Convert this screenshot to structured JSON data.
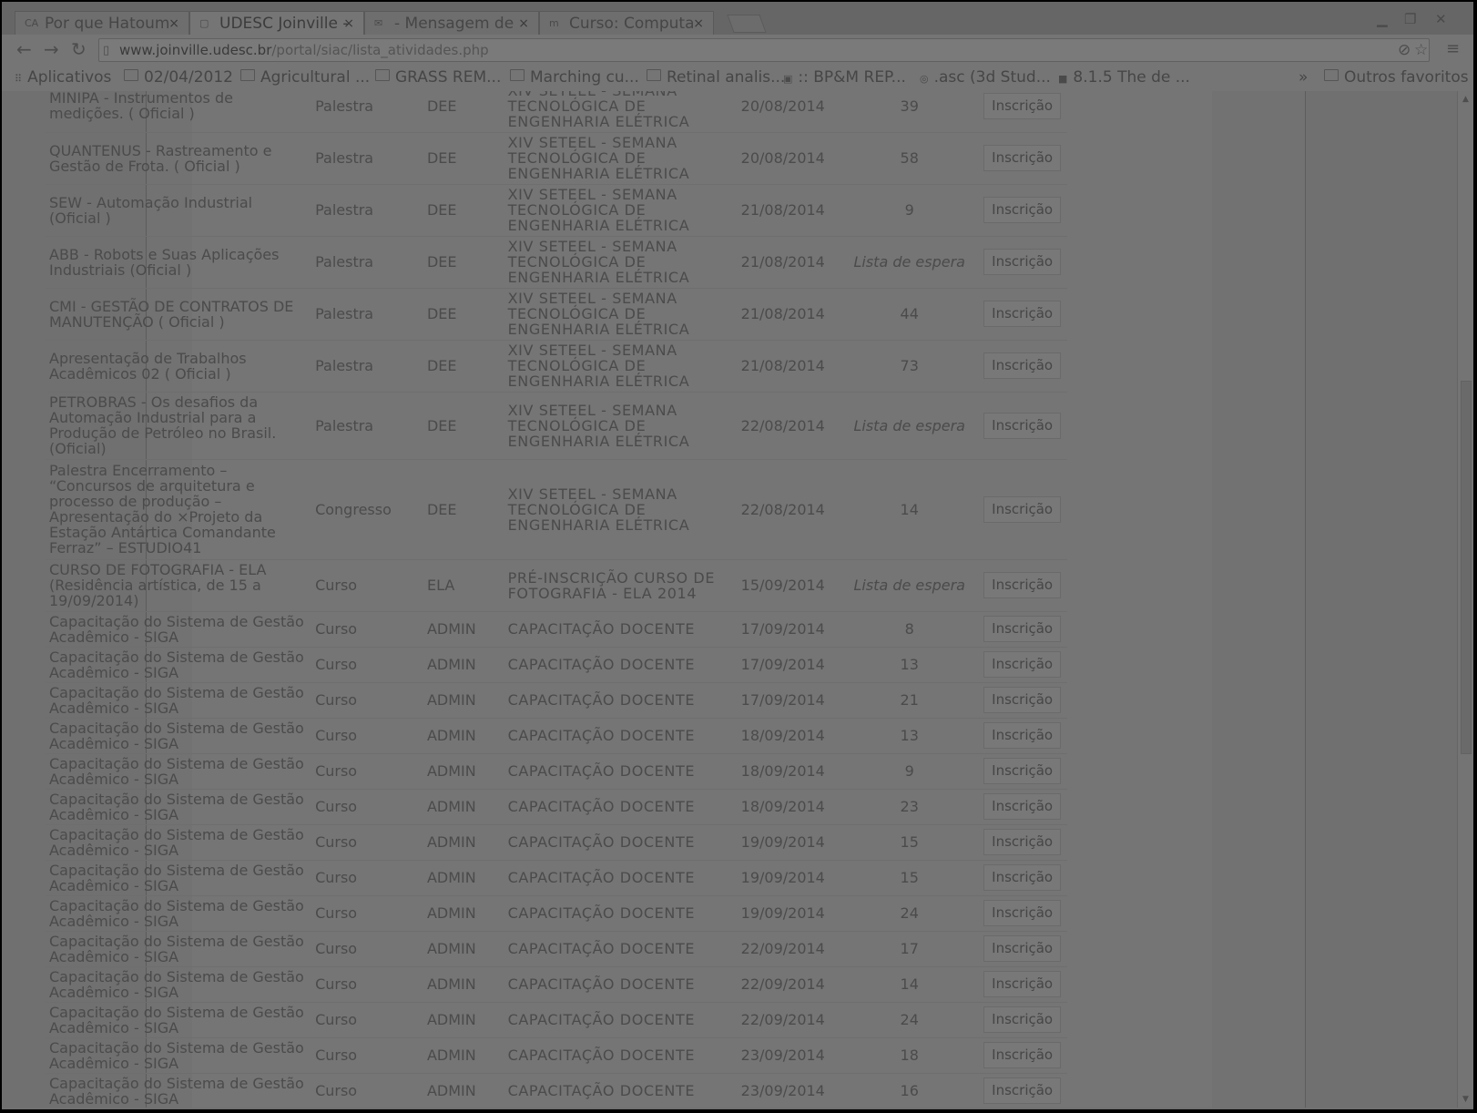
{
  "tabs": [
    {
      "label": "Por que Hatoum",
      "icon": "CA",
      "active": false
    },
    {
      "label": "UDESC Joinville -",
      "icon": "",
      "active": true
    },
    {
      "label": "- Mensagem de",
      "icon": "✉",
      "active": false
    },
    {
      "label": "Curso: Computa",
      "icon": "m",
      "active": false
    }
  ],
  "url": {
    "host": "www.joinville.udesc.br",
    "path": "/portal/siac/lista_atividades.php"
  },
  "bookmarks": {
    "apps": "Aplicativos",
    "items": [
      "02/04/2012",
      "Agricultural ...",
      "GRASS REM...",
      "Marching cu...",
      "Retinal analis...",
      ":: BP&M REP...",
      ".asc (3d Stud...",
      "8.1.5 The de ..."
    ],
    "other": "Outros favoritos"
  },
  "rows": [
    {
      "title": "MINIPA - Instrumentos de medições. ( Oficial )",
      "type": "Palestra",
      "dept": "DEE",
      "event": "XIV SETEEL - SEMANA TECNOLÓGICA DE ENGENHARIA ELÉTRICA",
      "date": "20/08/2014",
      "vacancies": "39",
      "action": "Inscrição"
    },
    {
      "title": "QUANTENUS - Rastreamento e Gestão de Frota. ( Oficial )",
      "type": "Palestra",
      "dept": "DEE",
      "event": "XIV SETEEL - SEMANA TECNOLÓGICA DE ENGENHARIA ELÉTRICA",
      "date": "20/08/2014",
      "vacancies": "58",
      "action": "Inscrição"
    },
    {
      "title": "SEW - Automação Industrial (Oficial )",
      "type": "Palestra",
      "dept": "DEE",
      "event": "XIV SETEEL - SEMANA TECNOLÓGICA DE ENGENHARIA ELÉTRICA",
      "date": "21/08/2014",
      "vacancies": "9",
      "action": "Inscrição"
    },
    {
      "title": "ABB - Robots e Suas Aplicações Industriais (Oficial )",
      "type": "Palestra",
      "dept": "DEE",
      "event": "XIV SETEEL - SEMANA TECNOLÓGICA DE ENGENHARIA ELÉTRICA",
      "date": "21/08/2014",
      "vacancies": "Lista de espera",
      "action": "Inscrição"
    },
    {
      "title": "CMI - GESTÃO DE CONTRATOS DE MANUTENÇÃO ( Oficial )",
      "type": "Palestra",
      "dept": "DEE",
      "event": "XIV SETEEL - SEMANA TECNOLÓGICA DE ENGENHARIA ELÉTRICA",
      "date": "21/08/2014",
      "vacancies": "44",
      "action": "Inscrição"
    },
    {
      "title": "Apresentação de Trabalhos Acadêmicos 02 ( Oficial )",
      "type": "Palestra",
      "dept": "DEE",
      "event": "XIV SETEEL - SEMANA TECNOLÓGICA DE ENGENHARIA ELÉTRICA",
      "date": "21/08/2014",
      "vacancies": "73",
      "action": "Inscrição"
    },
    {
      "title": "PETROBRAS - Os desafios da Automação Industrial para a Produção de Petróleo no Brasil. (Oficial)",
      "type": "Palestra",
      "dept": "DEE",
      "event": "XIV SETEEL - SEMANA TECNOLÓGICA DE ENGENHARIA ELÉTRICA",
      "date": "22/08/2014",
      "vacancies": "Lista de espera",
      "action": "Inscrição"
    },
    {
      "title": "Palestra Encerramento – “Concursos de arquitetura e processo de produção – Apresentação do ×Projeto da Estação Antártica Comandante Ferraz” – ESTUDIO41",
      "type": "Congresso",
      "dept": "DEE",
      "event": "XIV SETEEL - SEMANA TECNOLÓGICA DE ENGENHARIA ELÉTRICA",
      "date": "22/08/2014",
      "vacancies": "14",
      "action": "Inscrição"
    },
    {
      "title": "CURSO DE FOTOGRAFIA - ELA (Residência artística, de 15 a 19/09/2014)",
      "type": "Curso",
      "dept": "ELA",
      "event": "PRÉ-INSCRIÇÃO CURSO DE FOTOGRAFIA - ELA 2014",
      "date": "15/09/2014",
      "vacancies": "Lista de espera",
      "action": "Inscrição"
    },
    {
      "title": "Capacitação do Sistema de Gestão Acadêmico - SIGA",
      "type": "Curso",
      "dept": "ADMIN",
      "event": "CAPACITAÇÃO DOCENTE",
      "date": "17/09/2014",
      "vacancies": "8",
      "action": "Inscrição"
    },
    {
      "title": "Capacitação do Sistema de Gestão Acadêmico - SIGA",
      "type": "Curso",
      "dept": "ADMIN",
      "event": "CAPACITAÇÃO DOCENTE",
      "date": "17/09/2014",
      "vacancies": "13",
      "action": "Inscrição"
    },
    {
      "title": "Capacitação do Sistema de Gestão Acadêmico - SIGA",
      "type": "Curso",
      "dept": "ADMIN",
      "event": "CAPACITAÇÃO DOCENTE",
      "date": "17/09/2014",
      "vacancies": "21",
      "action": "Inscrição"
    },
    {
      "title": "Capacitação do Sistema de Gestão Acadêmico - SIGA",
      "type": "Curso",
      "dept": "ADMIN",
      "event": "CAPACITAÇÃO DOCENTE",
      "date": "18/09/2014",
      "vacancies": "13",
      "action": "Inscrição"
    },
    {
      "title": "Capacitação do Sistema de Gestão Acadêmico - SIGA",
      "type": "Curso",
      "dept": "ADMIN",
      "event": "CAPACITAÇÃO DOCENTE",
      "date": "18/09/2014",
      "vacancies": "9",
      "action": "Inscrição"
    },
    {
      "title": "Capacitação do Sistema de Gestão Acadêmico - SIGA",
      "type": "Curso",
      "dept": "ADMIN",
      "event": "CAPACITAÇÃO DOCENTE",
      "date": "18/09/2014",
      "vacancies": "23",
      "action": "Inscrição"
    },
    {
      "title": "Capacitação do Sistema de Gestão Acadêmico - SIGA",
      "type": "Curso",
      "dept": "ADMIN",
      "event": "CAPACITAÇÃO DOCENTE",
      "date": "19/09/2014",
      "vacancies": "15",
      "action": "Inscrição"
    },
    {
      "title": "Capacitação do Sistema de Gestão Acadêmico - SIGA",
      "type": "Curso",
      "dept": "ADMIN",
      "event": "CAPACITAÇÃO DOCENTE",
      "date": "19/09/2014",
      "vacancies": "15",
      "action": "Inscrição"
    },
    {
      "title": "Capacitação do Sistema de Gestão Acadêmico - SIGA",
      "type": "Curso",
      "dept": "ADMIN",
      "event": "CAPACITAÇÃO DOCENTE",
      "date": "19/09/2014",
      "vacancies": "24",
      "action": "Inscrição"
    },
    {
      "title": "Capacitação do Sistema de Gestão Acadêmico - SIGA",
      "type": "Curso",
      "dept": "ADMIN",
      "event": "CAPACITAÇÃO DOCENTE",
      "date": "22/09/2014",
      "vacancies": "17",
      "action": "Inscrição"
    },
    {
      "title": "Capacitação do Sistema de Gestão Acadêmico - SIGA",
      "type": "Curso",
      "dept": "ADMIN",
      "event": "CAPACITAÇÃO DOCENTE",
      "date": "22/09/2014",
      "vacancies": "14",
      "action": "Inscrição"
    },
    {
      "title": "Capacitação do Sistema de Gestão Acadêmico - SIGA",
      "type": "Curso",
      "dept": "ADMIN",
      "event": "CAPACITAÇÃO DOCENTE",
      "date": "22/09/2014",
      "vacancies": "24",
      "action": "Inscrição"
    },
    {
      "title": "Capacitação do Sistema de Gestão Acadêmico - SIGA",
      "type": "Curso",
      "dept": "ADMIN",
      "event": "CAPACITAÇÃO DOCENTE",
      "date": "23/09/2014",
      "vacancies": "18",
      "action": "Inscrição"
    },
    {
      "title": "Capacitação do Sistema de Gestão Acadêmico - SIGA",
      "type": "Curso",
      "dept": "ADMIN",
      "event": "CAPACITAÇÃO DOCENTE",
      "date": "23/09/2014",
      "vacancies": "16",
      "action": "Inscrição"
    }
  ]
}
